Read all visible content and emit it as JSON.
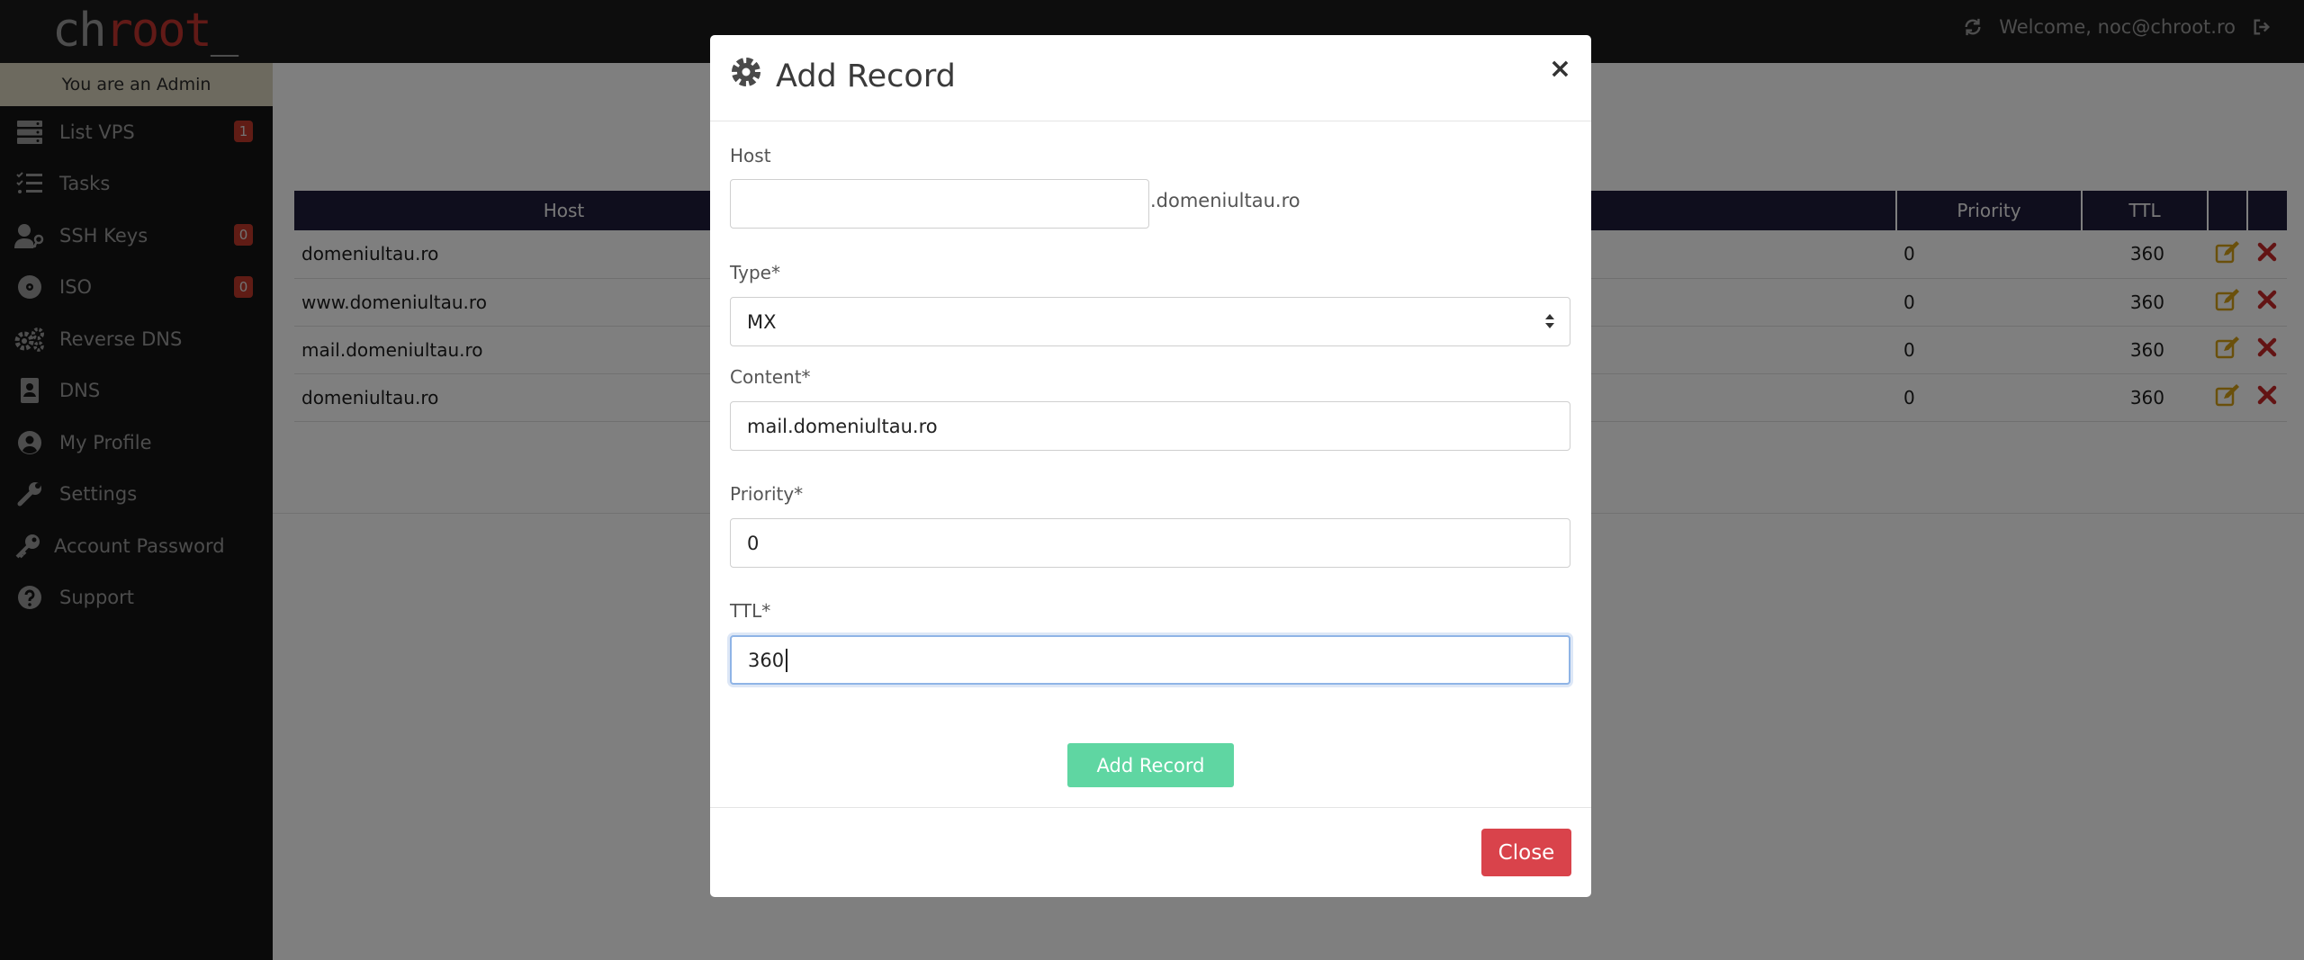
{
  "header": {
    "logo": {
      "part1": "ch",
      "part2": "root",
      "part3": "_"
    },
    "welcome_text": "Welcome, noc@chroot.ro",
    "icons": [
      "refresh-icon",
      "sign-out-icon"
    ]
  },
  "sidebar": {
    "admin_banner": "You are an Admin",
    "items": [
      {
        "label": "List VPS",
        "icon": "server-icon",
        "badge": "1"
      },
      {
        "label": "Tasks",
        "icon": "tasks-icon"
      },
      {
        "label": "SSH Keys",
        "icon": "user-key-icon",
        "badge": "0"
      },
      {
        "label": "ISO",
        "icon": "disc-icon",
        "badge": "0"
      },
      {
        "label": "Reverse DNS",
        "icon": "gears-icon"
      },
      {
        "label": "DNS",
        "icon": "address-book-icon"
      },
      {
        "label": "My Profile",
        "icon": "user-circle-icon"
      },
      {
        "label": "Settings",
        "icon": "wrench-icon"
      },
      {
        "label": "Account Password",
        "icon": "key-icon"
      },
      {
        "label": "Support",
        "icon": "question-circle-icon"
      }
    ]
  },
  "table": {
    "columns": {
      "host": "Host",
      "priority": "Priority",
      "ttl": "TTL"
    },
    "rows": [
      {
        "host": "domeniultau.ro",
        "priority": "0",
        "ttl": "360"
      },
      {
        "host": "www.domeniultau.ro",
        "priority": "0",
        "ttl": "360"
      },
      {
        "host": "mail.domeniultau.ro",
        "priority": "0",
        "ttl": "360"
      },
      {
        "host": "domeniultau.ro",
        "priority": "0",
        "ttl": "360"
      }
    ],
    "row_actions": [
      "edit-icon",
      "delete-icon"
    ]
  },
  "modal": {
    "title": "Add Record",
    "close_symbol": "×",
    "host": {
      "label": "Host",
      "value": "",
      "suffix": ".domeniultau.ro"
    },
    "type": {
      "label": "Type*",
      "value": "MX"
    },
    "content": {
      "label": "Content*",
      "value": "mail.domeniultau.ro"
    },
    "priority": {
      "label": "Priority*",
      "value": "0"
    },
    "ttl": {
      "label": "TTL*",
      "value": "360"
    },
    "submit_label": "Add Record",
    "close_label": "Close"
  },
  "colors": {
    "topbar": "#1b1b1b",
    "sidebar": "#151515",
    "admin_banner": "#dad4be",
    "table_header": "#1f1c3a",
    "logo_accent": "#c2352e",
    "submit_button": "#5fd6a2",
    "close_button": "#d9434b",
    "badge": "#c0392b",
    "edit_icon": "#d4a017",
    "delete_icon": "#c62828"
  }
}
